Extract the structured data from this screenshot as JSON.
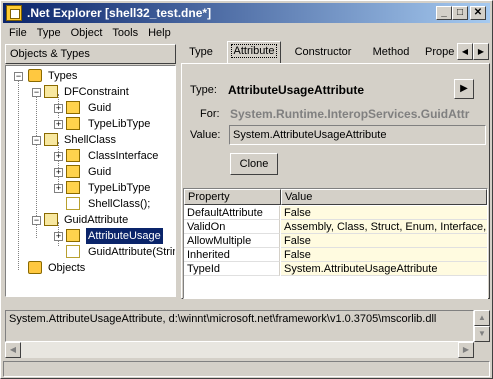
{
  "window": {
    "title": ".Net Explorer [shell32_test.dne*]",
    "minimize_glyph": "_",
    "maximize_glyph": "□",
    "close_glyph": "✕"
  },
  "menu": [
    "File",
    "Type",
    "Object",
    "Tools",
    "Help"
  ],
  "tree": {
    "header": "Objects & Types",
    "nodes": [
      {
        "label": "Types",
        "icon": "namespace-icon"
      },
      {
        "label": "DFConstraint",
        "icon": "class-icon"
      },
      {
        "label": "Guid",
        "icon": "type-icon"
      },
      {
        "label": "TypeLibType",
        "icon": "type-icon"
      },
      {
        "label": "ShellClass",
        "icon": "class-icon"
      },
      {
        "label": "ClassInterface",
        "icon": "type-icon"
      },
      {
        "label": "Guid",
        "icon": "type-icon"
      },
      {
        "label": "TypeLibType",
        "icon": "type-icon"
      },
      {
        "label": "ShellClass();",
        "icon": "method-icon"
      },
      {
        "label": "GuidAttribute",
        "icon": "class-icon"
      },
      {
        "label": "AttributeUsage",
        "icon": "type-icon"
      },
      {
        "label": "GuidAttribute(Strin",
        "icon": "method-icon"
      },
      {
        "label": "Objects",
        "icon": "folder-icon"
      }
    ]
  },
  "tabs": [
    "Type",
    "Attribute",
    "Constructor",
    "Method",
    "Prope"
  ],
  "detail": {
    "type_label": "Type:",
    "type_value": "AttributeUsageAttribute",
    "for_label": "For:",
    "for_value": "System.Runtime.InteropServices.GuidAttr",
    "value_label": "Value:",
    "value_text": "System.AttributeUsageAttribute",
    "clone_button": "Clone",
    "nav_button": "▶"
  },
  "grid": {
    "columns": [
      "Property",
      "Value"
    ],
    "rows": [
      [
        "DefaultAttribute",
        "False"
      ],
      [
        "ValidOn",
        "Assembly, Class, Struct, Enum, Interface, D"
      ],
      [
        "AllowMultiple",
        "False"
      ],
      [
        "Inherited",
        "False"
      ],
      [
        "TypeId",
        "System.AttributeUsageAttribute"
      ]
    ]
  },
  "status_text": "System.AttributeUsageAttribute, d:\\winnt\\microsoft.net\\framework\\v1.0.3705\\mscorlib.dll",
  "colors": {
    "title_start": "#0a246a",
    "title_end": "#a6caf0",
    "selection": "#0a246a",
    "face": "#d4d0c8"
  }
}
